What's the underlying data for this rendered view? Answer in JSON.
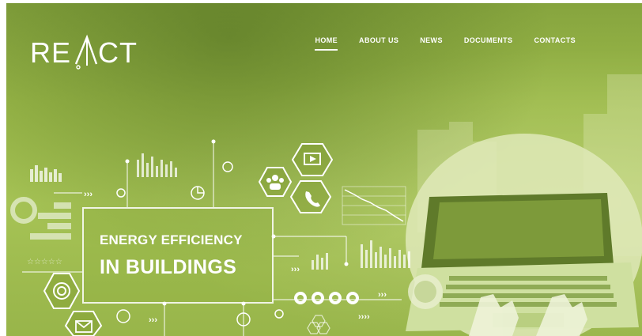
{
  "brand": {
    "name": "REACT"
  },
  "nav": {
    "items": [
      {
        "label": "HOME",
        "active": true
      },
      {
        "label": "ABOUT US",
        "active": false
      },
      {
        "label": "NEWS",
        "active": false
      },
      {
        "label": "DOCUMENTS",
        "active": false
      },
      {
        "label": "CONTACTS",
        "active": false
      }
    ]
  },
  "hero": {
    "line1": "ENERGY EFFICIENCY",
    "line2": "IN BUILDINGS"
  },
  "colors": {
    "accent": "#9cba4a",
    "text": "#ffffff"
  },
  "icons": [
    "people-icon",
    "phone-icon",
    "video-icon",
    "gear-icon",
    "target-icon",
    "mail-icon",
    "laptop-icon",
    "hands-icon",
    "bar-chart-icon",
    "pie-chart-icon"
  ]
}
